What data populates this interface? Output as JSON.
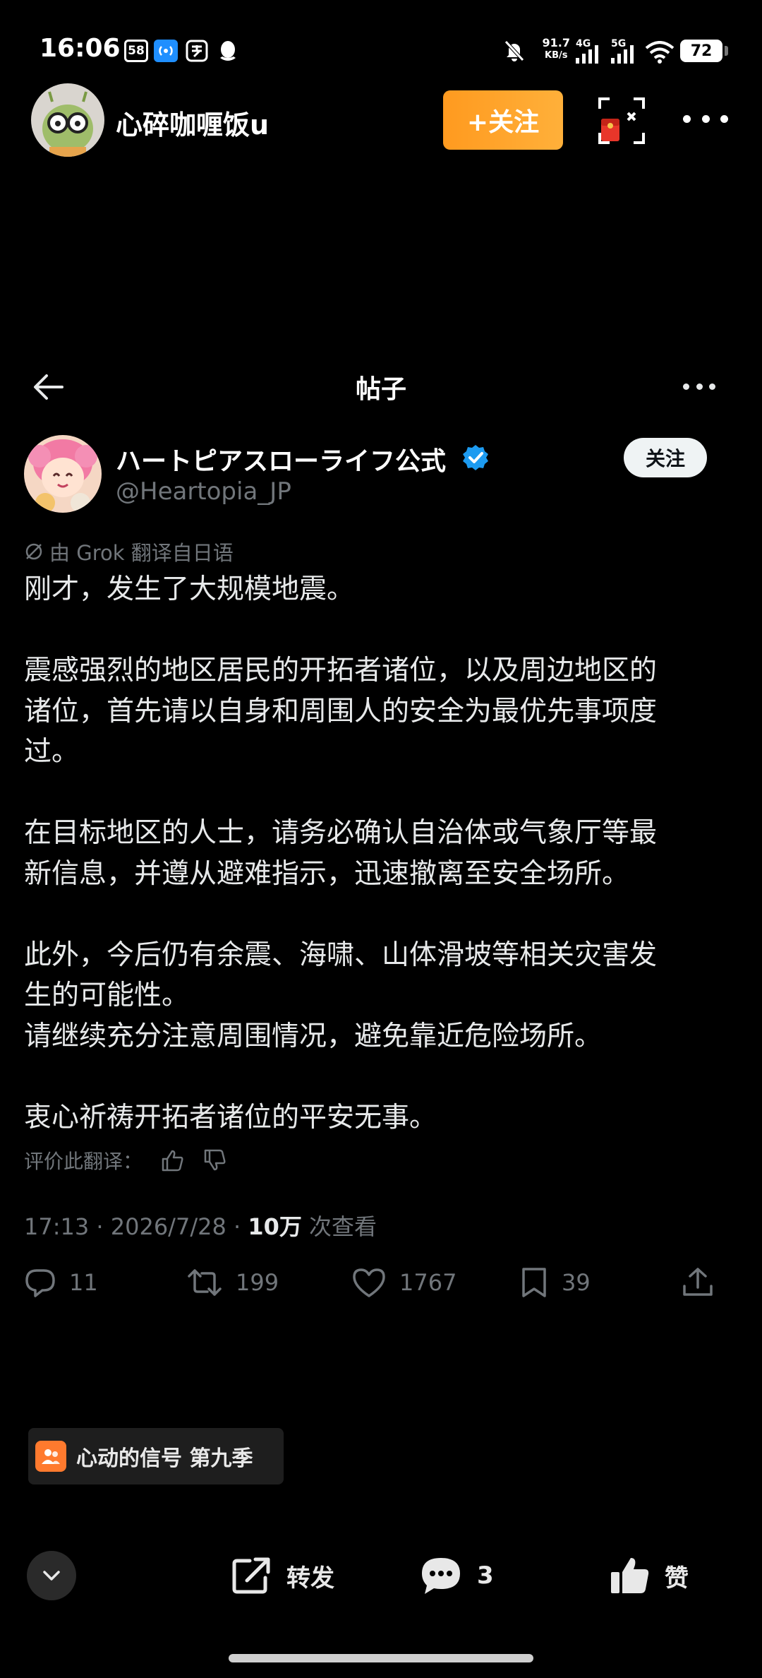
{
  "status_bar": {
    "time": "16:06",
    "badge_58": "58",
    "speed_value": "91.7",
    "speed_unit": "KB/s",
    "net_4g": "4G",
    "net_5g": "5G",
    "battery": "72"
  },
  "top_header": {
    "username": "心碎咖喱饭u",
    "follow_label": "+关注"
  },
  "post_header": {
    "title": "帖子"
  },
  "author": {
    "name": "ハートピアスローライフ公式",
    "handle": "@Heartopia_JP",
    "follow_label": "关注",
    "verified": true
  },
  "post": {
    "translate_note": "由 Grok 翻译自日语",
    "paragraphs": [
      "刚才，发生了大规模地震。",
      "",
      "震感强烈的地区居民的开拓者诸位，以及周边地区的",
      "诸位，首先请以自身和周围人的安全为最优先事项度",
      "过。",
      "",
      "在目标地区的人士，请务必确认自治体或气象厅等最",
      "新信息，并遵从避难指示，迅速撤离至安全场所。",
      "",
      "此外，今后仍有余震、海啸、山体滑坡等相关灾害发",
      "生的可能性。",
      "请继续充分注意周围情况，避免靠近危险场所。",
      "",
      "衷心祈祷开拓者诸位的平安无事。"
    ],
    "rate_translation": "评价此翻译：",
    "time": "17:13",
    "date": "2026/7/28",
    "views_count": "10万",
    "views_label": "次查看"
  },
  "actions": {
    "replies": "11",
    "reposts": "199",
    "likes": "1767",
    "bookmarks": "39"
  },
  "chip": {
    "label": "心动的信号 第九季"
  },
  "bottom_bar": {
    "share_label": "转发",
    "comment_count": "3",
    "like_label": "赞"
  },
  "colors": {
    "follow_orange": "#ffa02a",
    "verified_blue": "#1d9bf0",
    "muted_text": "#71767b"
  }
}
